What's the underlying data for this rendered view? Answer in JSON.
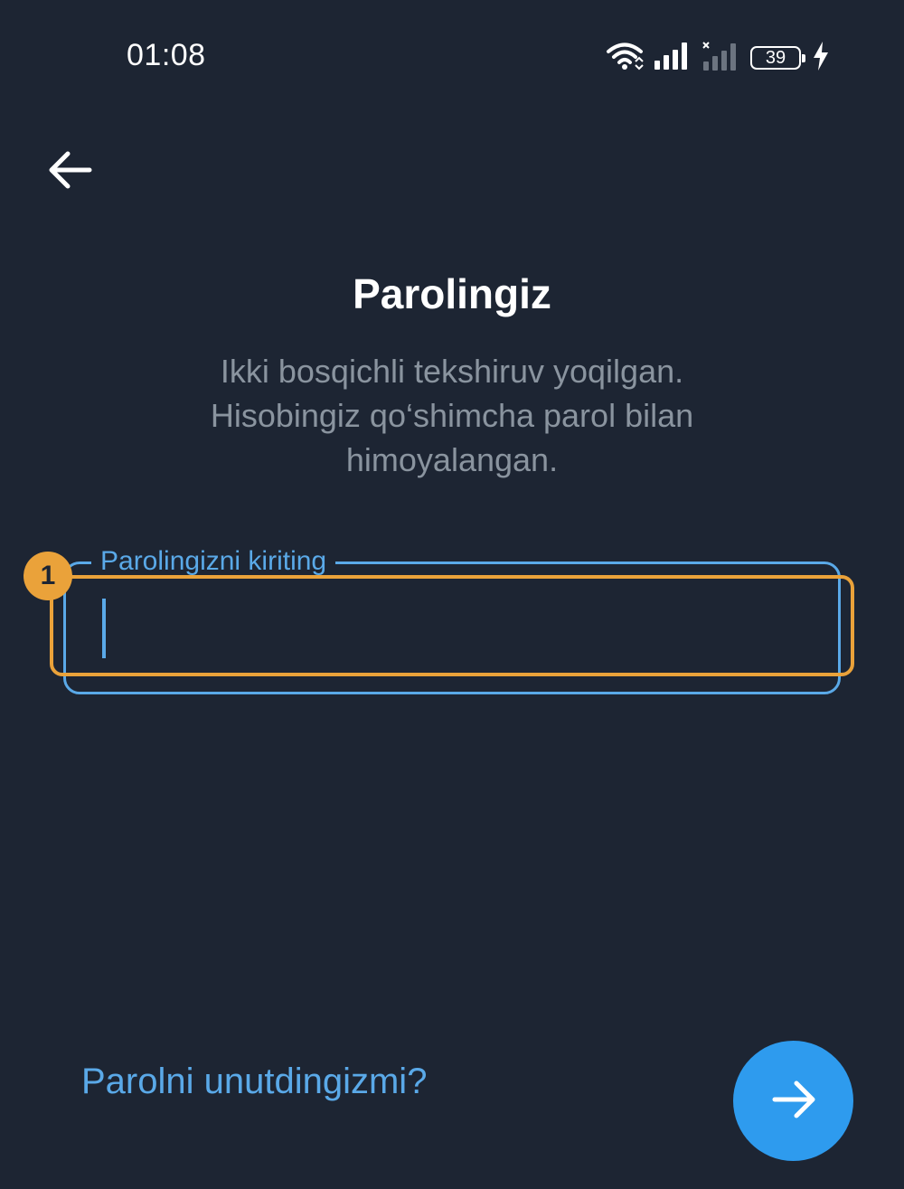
{
  "status_bar": {
    "time": "01:08",
    "battery_level": "39",
    "icons": [
      "wifi-icon",
      "signal-icon",
      "signal-off-icon",
      "battery-icon",
      "charging-icon"
    ]
  },
  "header": {
    "back_icon": "arrow-left-icon"
  },
  "main": {
    "title": "Parolingiz",
    "subtitle_lines": [
      "Ikki bosqichli tekshiruv yoqilgan.",
      "Hisobingiz qo‘shimcha parol bilan",
      "himoyalangan."
    ],
    "password_field": {
      "label": "Parolingizni kiriting",
      "value": ""
    },
    "marker_number": "1"
  },
  "footer": {
    "forgot_link": "Parolni unutdingizmi?",
    "next_icon": "arrow-right-icon"
  },
  "colors": {
    "background": "#1d2533",
    "accent": "#5aa9e8",
    "button": "#2e9bee",
    "highlight": "#eaa23a",
    "muted_text": "#8a949f"
  }
}
